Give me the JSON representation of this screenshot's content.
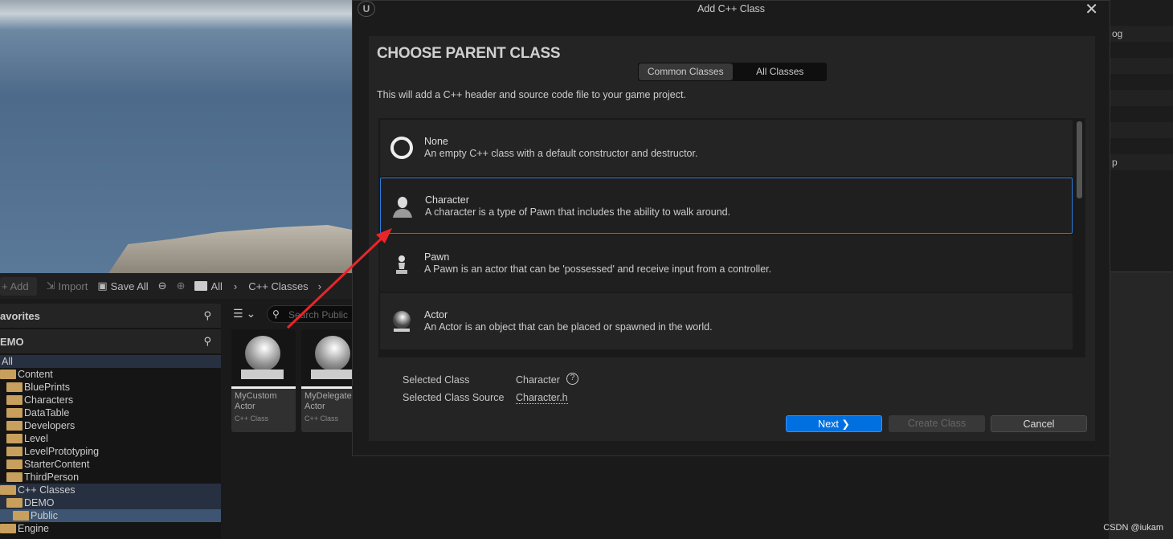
{
  "right_panel": {
    "row_texts": [
      "og",
      "p"
    ]
  },
  "toolbar": {
    "add": "+ Add",
    "import": "Import",
    "save_all": "Save All",
    "breadcrumb": [
      "All",
      "C++ Classes"
    ]
  },
  "tree": {
    "favorites": "avorites",
    "project": "EMO",
    "items": [
      {
        "label": "All",
        "level": 0,
        "sel": "sel"
      },
      {
        "label": "Content",
        "level": 0
      },
      {
        "label": "BluePrints",
        "level": 1
      },
      {
        "label": "Characters",
        "level": 1
      },
      {
        "label": "DataTable",
        "level": 1
      },
      {
        "label": "Developers",
        "level": 1
      },
      {
        "label": "Level",
        "level": 1
      },
      {
        "label": "LevelPrototyping",
        "level": 1
      },
      {
        "label": "StarterContent",
        "level": 1
      },
      {
        "label": "ThirdPerson",
        "level": 1
      },
      {
        "label": "C++ Classes",
        "level": 0,
        "sel": "sel"
      },
      {
        "label": "DEMO",
        "level": 1,
        "sel": "sel"
      },
      {
        "label": "Public",
        "level": 2,
        "sel": "sel2"
      },
      {
        "label": "Engine",
        "level": 0
      }
    ]
  },
  "assets": {
    "search_placeholder": "Search Public",
    "tiles": [
      {
        "name": "MyCustom Actor",
        "type": "C++ Class"
      },
      {
        "name": "MyDelegate Actor",
        "type": "C++ Class"
      }
    ]
  },
  "dialog": {
    "title": "Add C++ Class",
    "heading": "CHOOSE PARENT CLASS",
    "tabs": [
      "Common Classes",
      "All Classes"
    ],
    "active_tab": "Common Classes",
    "description": "This will add a C++ header and source code file to your game project.",
    "classes": [
      {
        "name": "None",
        "desc": "An empty C++ class with a default constructor and destructor."
      },
      {
        "name": "Character",
        "desc": "A character is a type of Pawn that includes the ability to walk around."
      },
      {
        "name": "Pawn",
        "desc": "A Pawn is an actor that can be 'possessed' and receive input from a controller."
      },
      {
        "name": "Actor",
        "desc": "An Actor is an object that can be placed or spawned in the world."
      }
    ],
    "selected_class_label": "Selected Class",
    "selected_class": "Character",
    "selected_source_label": "Selected Class Source",
    "selected_source": "Character.h",
    "buttons": {
      "next": "Next ❯",
      "create": "Create Class",
      "cancel": "Cancel"
    },
    "accent": "#0070e0"
  },
  "watermark": "CSDN @iukam"
}
